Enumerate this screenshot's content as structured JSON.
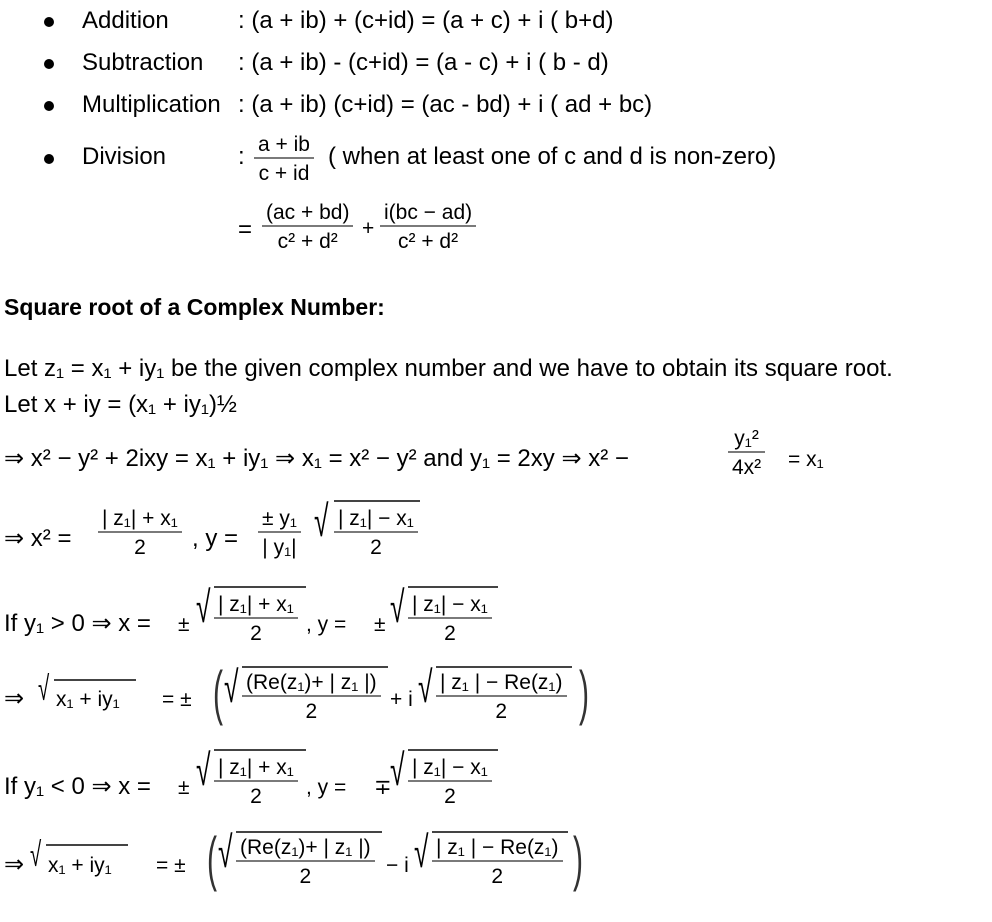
{
  "operations": [
    {
      "label": "Addition",
      "formula": ": (a + ib) + (c+id) = (a + c) + i ( b+d)"
    },
    {
      "label": "Subtraction",
      "formula": ": (a + ib) - (c+id) = (a - c) + i ( b - d)"
    },
    {
      "label": "Multiplication",
      "formula": ": (a + ib) (c+id) = (ac - bd) + i ( ad + bc)"
    },
    {
      "label": "Division",
      "colon": ":",
      "frac_num": "a + ib",
      "frac_den": "c + id",
      "note": "( when at least one of c and d is non-zero)"
    }
  ],
  "division_result": {
    "equals": "=",
    "term1_num": "(ac + bd)",
    "term1_den": "c² + d²",
    "plus": "+",
    "term2_num": "i(bc − ad)",
    "term2_den": "c² + d²"
  },
  "section": {
    "heading": "Square root of a Complex Number:",
    "intro_line1": "Let z₁ = x₁ + iy₁ be the given complex number and we have to obtain its square root.",
    "intro_line2": "Let x + iy = (x₁ + iy₁)½",
    "derivation_line": "⇒  x² − y² + 2ixy = x₁ + iy₁ ⇒  x₁ = x² − y² and y₁ = 2xy  ⇒ x² −",
    "derivation_frac_num": "y₁²",
    "derivation_frac_den": "4x²",
    "derivation_rhs": "= x₁",
    "x2_prefix": "⇒  x² =",
    "x2_num": "| z₁| + x₁",
    "x2_den": "2",
    "y_prefix": ",   y =",
    "y_sign_num": "± y₁",
    "y_sign_den": "| y₁|",
    "y_sqrt_num": "| z₁| − x₁",
    "y_sqrt_den": "2"
  },
  "cases": [
    {
      "condition": "If y₁ > 0 ⇒ x =",
      "x_sign": "±",
      "x_num": "| z₁| + x₁",
      "x_den": "2",
      "y_label": ",   y =",
      "y_sign": "±",
      "y_num": "| z₁| − x₁",
      "y_den": "2",
      "result_prefix": "⇒",
      "result_radicand": "x₁ + iy₁",
      "result_eq": "= ±",
      "re_num": "(Re(z₁)+ | z₁ |)",
      "re_den": "2",
      "op": "+ i",
      "im_num": "| z₁ | − Re(z₁)",
      "im_den": "2"
    },
    {
      "condition": "If y₁ < 0 ⇒ x =",
      "x_sign": "±",
      "x_num": "| z₁| + x₁",
      "x_den": "2",
      "y_label": ",   y =",
      "y_sign": "∓",
      "y_num": "| z₁| − x₁",
      "y_den": "2",
      "result_prefix": "⇒",
      "result_radicand": "x₁ + iy₁",
      "result_eq": "= ±",
      "re_num": "(Re(z₁)+ | z₁ |)",
      "re_den": "2",
      "op": "− i",
      "im_num": "| z₁ | − Re(z₁)",
      "im_den": "2"
    }
  ]
}
